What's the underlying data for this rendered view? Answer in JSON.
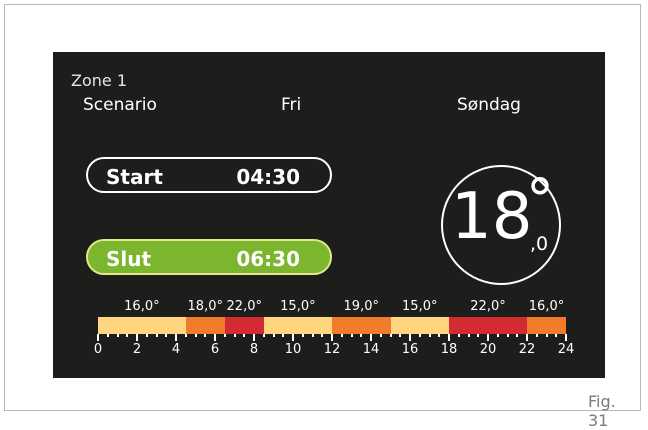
{
  "zone_title": "Zone 1",
  "header": {
    "scenario": "Scenario",
    "mode": "Fri",
    "day": "Søndag"
  },
  "start": {
    "label": "Start",
    "time": "04:30"
  },
  "end": {
    "label": "Slut",
    "time": "06:30"
  },
  "current_temp": {
    "integer": "18",
    "degree": "°",
    "decimal": ",0"
  },
  "timeline": {
    "hours_total": 24,
    "hour_labels": [
      "0",
      "2",
      "4",
      "6",
      "8",
      "10",
      "12",
      "14",
      "16",
      "18",
      "20",
      "22",
      "24"
    ],
    "segments": [
      {
        "start": 0,
        "end": 4.5,
        "temp": "16,0°",
        "color": "#ffd57f"
      },
      {
        "start": 4.5,
        "end": 6.5,
        "temp": "18,0°",
        "color": "#f07b2a"
      },
      {
        "start": 6.5,
        "end": 8.5,
        "temp": "22,0°",
        "color": "#d42a33"
      },
      {
        "start": 8.5,
        "end": 12,
        "temp": "15,0°",
        "color": "#ffd57f"
      },
      {
        "start": 12,
        "end": 15,
        "temp": "19,0°",
        "color": "#f07b2a"
      },
      {
        "start": 15,
        "end": 18,
        "temp": "15,0°",
        "color": "#ffd57f"
      },
      {
        "start": 18,
        "end": 22,
        "temp": "22,0°",
        "color": "#d42a33"
      },
      {
        "start": 22,
        "end": 24,
        "temp": "16,0°",
        "color": "#f07b2a"
      }
    ]
  },
  "figure_caption": "Fig. 31"
}
